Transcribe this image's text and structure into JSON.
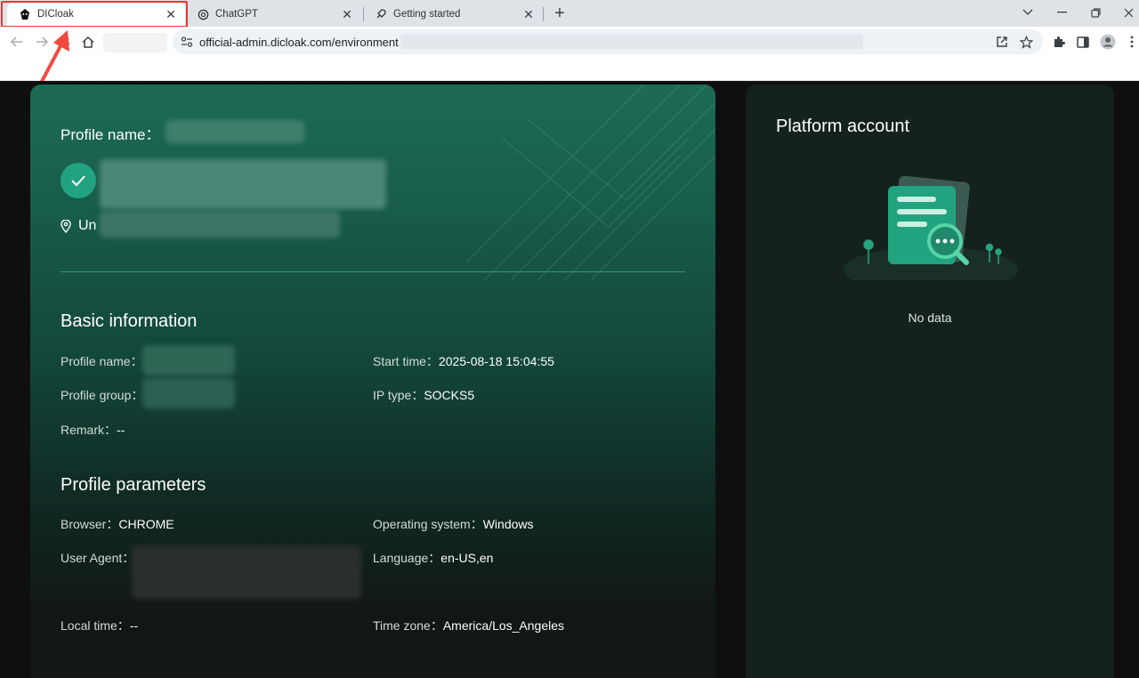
{
  "browser": {
    "tabs": [
      {
        "title": "DICloak",
        "icon": "dicloak-logo-icon",
        "active": true
      },
      {
        "title": "ChatGPT",
        "icon": "chatgpt-logo-icon",
        "active": false
      },
      {
        "title": "Getting started",
        "icon": "rocket-icon",
        "active": false
      }
    ],
    "close_glyph": "✕",
    "new_tab_glyph": "+",
    "url": "official-admin.dicloak.com/environment",
    "window_controls": [
      "chevron-down-icon",
      "minimize-icon",
      "restore-icon",
      "close-icon"
    ]
  },
  "profile_card": {
    "title": "Profile name：",
    "location_prefix": "Un"
  },
  "basic_info": {
    "title": "Basic information",
    "profile_name_label": "Profile name：",
    "profile_group_label": "Profile group：",
    "remark_label": "Remark：",
    "remark_value": "--",
    "start_time_label": "Start time：",
    "start_time_value": "2025-08-18 15:04:55",
    "ip_type_label": "IP type：",
    "ip_type_value": "SOCKS5"
  },
  "profile_params": {
    "title": "Profile parameters",
    "browser_label": "Browser：",
    "browser_value": "CHROME",
    "user_agent_label": "User Agent：",
    "local_time_label": "Local time：",
    "local_time_value": "--",
    "os_label": "Operating system：",
    "os_value": "Windows",
    "language_label": "Language：",
    "language_value": "en-US,en",
    "timezone_label": "Time zone：",
    "timezone_value": "America/Los_Angeles"
  },
  "platform": {
    "title": "Platform account",
    "empty_text": "No data"
  },
  "colors": {
    "accent": "#22a37f",
    "highlight": "#e53935",
    "card_top": "#1d6b55",
    "panel_bg": "#14211d"
  }
}
